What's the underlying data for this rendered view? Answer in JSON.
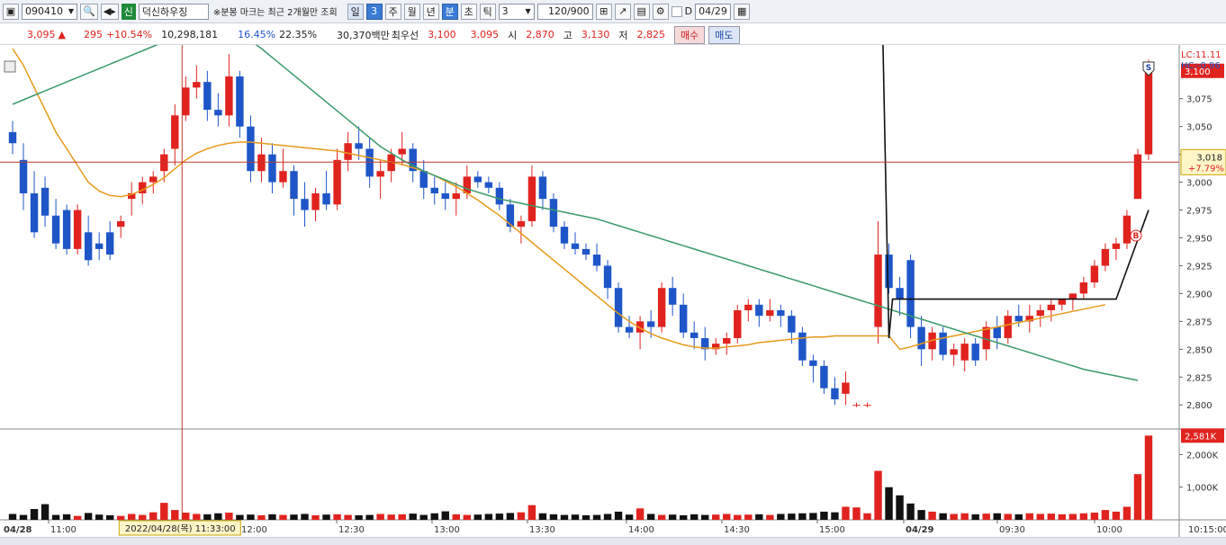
{
  "toolbar": {
    "code": "090410",
    "stock_badge": "신",
    "stock_name": "덕신하우징",
    "notice": "※분봉 마크는 최근 2개월만 조회",
    "period_buttons": [
      "일",
      "3",
      "주",
      "월",
      "년",
      "분",
      "초",
      "틱"
    ],
    "interval_value": "3",
    "count_value": "120/900",
    "date_value": "04/29",
    "d_label": "D"
  },
  "info": {
    "price": "3,095",
    "arrow": "▲",
    "change": "295",
    "change_pct": "+10.54%",
    "volume": "10,298,181",
    "turnover": "16.45%",
    "ratio": "22.35%",
    "amount": "30,370백만",
    "best_label": "최우선",
    "best_sell": "3,100",
    "best_buy": "3,095",
    "open_label": "시",
    "open": "2,870",
    "high_label": "고",
    "high": "3,130",
    "low_label": "저",
    "low": "2,825",
    "buy_button": "매수",
    "sell_button": "매도"
  },
  "colors": {
    "up": "#e0231e",
    "down": "#1e56c8",
    "ma_short": "#e89a1a",
    "ma_long": "#3a9a6a",
    "crosshair": "#c0392b",
    "line": "#111111"
  },
  "chart_data": {
    "type": "candlestick",
    "price_axis_ticks": [
      "3,075",
      "3,050",
      "3,025",
      "3,000",
      "2,975",
      "2,950",
      "2,925",
      "2,900",
      "2,875",
      "2,850",
      "2,825",
      "2,800"
    ],
    "ylim": [
      2780,
      3120
    ],
    "volume_axis_ticks": [
      "2,000K",
      "1,000K"
    ],
    "volume_ylim": [
      0,
      2700000
    ],
    "x_ticks": [
      "04/28",
      "11:00",
      "12:00",
      "12:30",
      "13:00",
      "13:30",
      "14:00",
      "14:30",
      "15:00",
      "04/29",
      "09:30",
      "10:00",
      "10:15:00"
    ],
    "top_labels": [
      "LC:11.11",
      "HC:-0.96"
    ],
    "last_price_label": "3,100",
    "crosshair_price_label": "3,018",
    "crosshair_pct_label": "+7.79%",
    "crosshair_time_label": "2022/04/28(목) 11:33:00",
    "current_volume_label": "2,581K",
    "markers": {
      "sell": "S",
      "buy": "B"
    },
    "crosshair_price": 3018,
    "candles": [
      [
        3045,
        3055,
        3025,
        3035
      ],
      [
        3020,
        3035,
        2975,
        2990
      ],
      [
        2990,
        3010,
        2950,
        2955
      ],
      [
        2995,
        3005,
        2960,
        2970
      ],
      [
        2970,
        2985,
        2940,
        2945
      ],
      [
        2975,
        2980,
        2935,
        2940
      ],
      [
        2940,
        2980,
        2935,
        2975
      ],
      [
        2955,
        2970,
        2925,
        2930
      ],
      [
        2945,
        2955,
        2930,
        2940
      ],
      [
        2955,
        2965,
        2930,
        2935
      ],
      [
        2960,
        2970,
        2950,
        2965
      ],
      [
        2985,
        3000,
        2970,
        2990
      ],
      [
        2990,
        3005,
        2980,
        3000
      ],
      [
        3000,
        3010,
        2990,
        3005
      ],
      [
        3010,
        3030,
        3000,
        3025
      ],
      [
        3030,
        3070,
        3015,
        3060
      ],
      [
        3060,
        3095,
        3055,
        3085
      ],
      [
        3085,
        3105,
        3075,
        3090
      ],
      [
        3090,
        3100,
        3055,
        3065
      ],
      [
        3065,
        3080,
        3050,
        3060
      ],
      [
        3060,
        3115,
        3050,
        3095
      ],
      [
        3095,
        3100,
        3040,
        3050
      ],
      [
        3050,
        3060,
        3000,
        3010
      ],
      [
        3010,
        3040,
        3000,
        3025
      ],
      [
        3025,
        3035,
        2990,
        3000
      ],
      [
        3000,
        3030,
        2995,
        3010
      ],
      [
        3010,
        3015,
        2970,
        2985
      ],
      [
        2985,
        3000,
        2960,
        2975
      ],
      [
        2975,
        2995,
        2965,
        2990
      ],
      [
        2990,
        3010,
        2975,
        2980
      ],
      [
        2980,
        3030,
        2975,
        3020
      ],
      [
        3020,
        3045,
        3010,
        3035
      ],
      [
        3035,
        3050,
        3020,
        3030
      ],
      [
        3030,
        3040,
        2995,
        3005
      ],
      [
        3005,
        3020,
        2985,
        3010
      ],
      [
        3010,
        3030,
        3000,
        3025
      ],
      [
        3025,
        3045,
        3015,
        3030
      ],
      [
        3030,
        3035,
        3000,
        3010
      ],
      [
        3010,
        3020,
        2985,
        2995
      ],
      [
        2995,
        3005,
        2980,
        2990
      ],
      [
        2990,
        3000,
        2975,
        2985
      ],
      [
        2985,
        3000,
        2970,
        2990
      ],
      [
        2990,
        3015,
        2985,
        3005
      ],
      [
        3005,
        3010,
        2995,
        3000
      ],
      [
        3000,
        3005,
        2990,
        2995
      ],
      [
        2995,
        3000,
        2975,
        2980
      ],
      [
        2980,
        2985,
        2955,
        2960
      ],
      [
        2960,
        2970,
        2945,
        2965
      ],
      [
        2965,
        3015,
        2960,
        3005
      ],
      [
        3005,
        3010,
        2975,
        2985
      ],
      [
        2985,
        2990,
        2955,
        2960
      ],
      [
        2960,
        2965,
        2940,
        2945
      ],
      [
        2945,
        2955,
        2935,
        2940
      ],
      [
        2940,
        2945,
        2930,
        2935
      ],
      [
        2935,
        2945,
        2920,
        2925
      ],
      [
        2925,
        2930,
        2895,
        2905
      ],
      [
        2905,
        2910,
        2865,
        2870
      ],
      [
        2870,
        2880,
        2860,
        2865
      ],
      [
        2865,
        2880,
        2850,
        2875
      ],
      [
        2875,
        2885,
        2860,
        2870
      ],
      [
        2870,
        2910,
        2865,
        2905
      ],
      [
        2905,
        2915,
        2880,
        2890
      ],
      [
        2890,
        2900,
        2860,
        2865
      ],
      [
        2865,
        2875,
        2850,
        2860
      ],
      [
        2860,
        2870,
        2840,
        2850
      ],
      [
        2850,
        2860,
        2845,
        2855
      ],
      [
        2855,
        2865,
        2845,
        2860
      ],
      [
        2860,
        2890,
        2855,
        2885
      ],
      [
        2885,
        2895,
        2875,
        2890
      ],
      [
        2890,
        2895,
        2870,
        2880
      ],
      [
        2880,
        2895,
        2875,
        2885
      ],
      [
        2885,
        2890,
        2870,
        2880
      ],
      [
        2880,
        2885,
        2855,
        2865
      ],
      [
        2865,
        2870,
        2835,
        2840
      ],
      [
        2840,
        2845,
        2820,
        2835
      ],
      [
        2835,
        2840,
        2810,
        2815
      ],
      [
        2815,
        2825,
        2800,
        2805
      ],
      [
        2810,
        2830,
        2800,
        2820
      ],
      [
        2800,
        2802,
        2798,
        2800
      ],
      [
        2800,
        2802,
        2798,
        2800
      ],
      [
        2870,
        2965,
        2855,
        2935
      ],
      [
        2935,
        2945,
        2900,
        2905
      ],
      [
        2905,
        2915,
        2880,
        2895
      ],
      [
        2930,
        2935,
        2860,
        2870
      ],
      [
        2870,
        2880,
        2835,
        2850
      ],
      [
        2850,
        2870,
        2840,
        2865
      ],
      [
        2865,
        2870,
        2840,
        2845
      ],
      [
        2845,
        2855,
        2835,
        2850
      ],
      [
        2840,
        2860,
        2830,
        2855
      ],
      [
        2855,
        2860,
        2835,
        2840
      ],
      [
        2850,
        2875,
        2840,
        2870
      ],
      [
        2870,
        2880,
        2850,
        2860
      ],
      [
        2860,
        2885,
        2855,
        2880
      ],
      [
        2880,
        2890,
        2870,
        2875
      ],
      [
        2875,
        2890,
        2865,
        2880
      ],
      [
        2880,
        2890,
        2870,
        2885
      ],
      [
        2885,
        2895,
        2875,
        2890
      ],
      [
        2890,
        2895,
        2885,
        2895
      ],
      [
        2895,
        2900,
        2885,
        2900
      ],
      [
        2900,
        2915,
        2895,
        2910
      ],
      [
        2910,
        2930,
        2905,
        2925
      ],
      [
        2925,
        2945,
        2920,
        2940
      ],
      [
        2940,
        2950,
        2930,
        2945
      ],
      [
        2945,
        2975,
        2940,
        2970
      ],
      [
        2985,
        3030,
        2985,
        3025
      ],
      [
        3025,
        3110,
        3020,
        3100
      ]
    ],
    "ma_short": [
      3120,
      3105,
      3085,
      3065,
      3045,
      3030,
      3015,
      3000,
      2992,
      2988,
      2987,
      2989,
      2993,
      2998,
      3004,
      3012,
      3020,
      3026,
      3030,
      3033,
      3035,
      3036,
      3036,
      3035,
      3034,
      3033,
      3032,
      3031,
      3030,
      3029,
      3028,
      3026,
      3024,
      3022,
      3020,
      3018,
      3016,
      3013,
      3010,
      3006,
      3001,
      2996,
      2990,
      2984,
      2977,
      2970,
      2962,
      2954,
      2946,
      2938,
      2930,
      2922,
      2914,
      2906,
      2898,
      2890,
      2882,
      2875,
      2869,
      2864,
      2860,
      2857,
      2854,
      2852,
      2851,
      2851,
      2852,
      2853,
      2854,
      2856,
      2857,
      2858,
      2859,
      2860,
      2861,
      2861,
      2862,
      2862,
      2862,
      2862,
      2862,
      2862,
      2850,
      2852,
      2855,
      2858,
      2860,
      2862,
      2864,
      2866,
      2868,
      2870,
      2872,
      2874,
      2876,
      2878,
      2880,
      2882,
      2884,
      2886,
      2888,
      2890
    ],
    "ma_long": [
      3070,
      3074,
      3078,
      3082,
      3086,
      3090,
      3094,
      3098,
      3102,
      3106,
      3110,
      3114,
      3118,
      3122,
      3126,
      3130,
      3134,
      3138,
      3142,
      3145,
      3140,
      3134,
      3127,
      3120,
      3112,
      3104,
      3096,
      3088,
      3080,
      3072,
      3064,
      3056,
      3048,
      3040,
      3032,
      3026,
      3020,
      3015,
      3010,
      3006,
      3002,
      2998,
      2994,
      2991,
      2988,
      2985,
      2983,
      2981,
      2979,
      2977,
      2975,
      2973,
      2971,
      2969,
      2967,
      2964,
      2961,
      2958,
      2955,
      2952,
      2949,
      2946,
      2943,
      2940,
      2937,
      2934,
      2931,
      2928,
      2925,
      2922,
      2919,
      2916,
      2913,
      2910,
      2907,
      2904,
      2901,
      2898,
      2895,
      2892,
      2889,
      2886,
      2883,
      2880,
      2877,
      2874,
      2871,
      2868,
      2865,
      2862,
      2859,
      2856,
      2853,
      2850,
      2847,
      2844,
      2841,
      2838,
      2835,
      2832,
      2830,
      2828,
      2826,
      2824,
      2822
    ],
    "volumes": [
      180,
      150,
      330,
      480,
      150,
      170,
      120,
      210,
      160,
      140,
      120,
      180,
      150,
      230,
      520,
      300,
      220,
      180,
      170,
      200,
      220,
      150,
      160,
      140,
      170,
      150,
      160,
      180,
      140,
      160,
      170,
      150,
      140,
      150,
      180,
      160,
      170,
      190,
      150,
      200,
      260,
      170,
      150,
      160,
      180,
      190,
      210,
      230,
      450,
      200,
      170,
      150,
      160,
      140,
      150,
      180,
      250,
      160,
      350,
      180,
      150,
      160,
      140,
      170,
      150,
      160,
      180,
      150,
      160,
      170,
      150,
      180,
      190,
      200,
      210,
      250,
      230,
      400,
      380,
      200,
      1500,
      1000,
      750,
      500,
      300,
      250,
      200,
      180,
      200,
      170,
      190,
      200,
      180,
      170,
      200,
      180,
      190,
      170,
      180,
      200,
      220,
      300,
      250,
      400,
      1400,
      2581
    ]
  }
}
